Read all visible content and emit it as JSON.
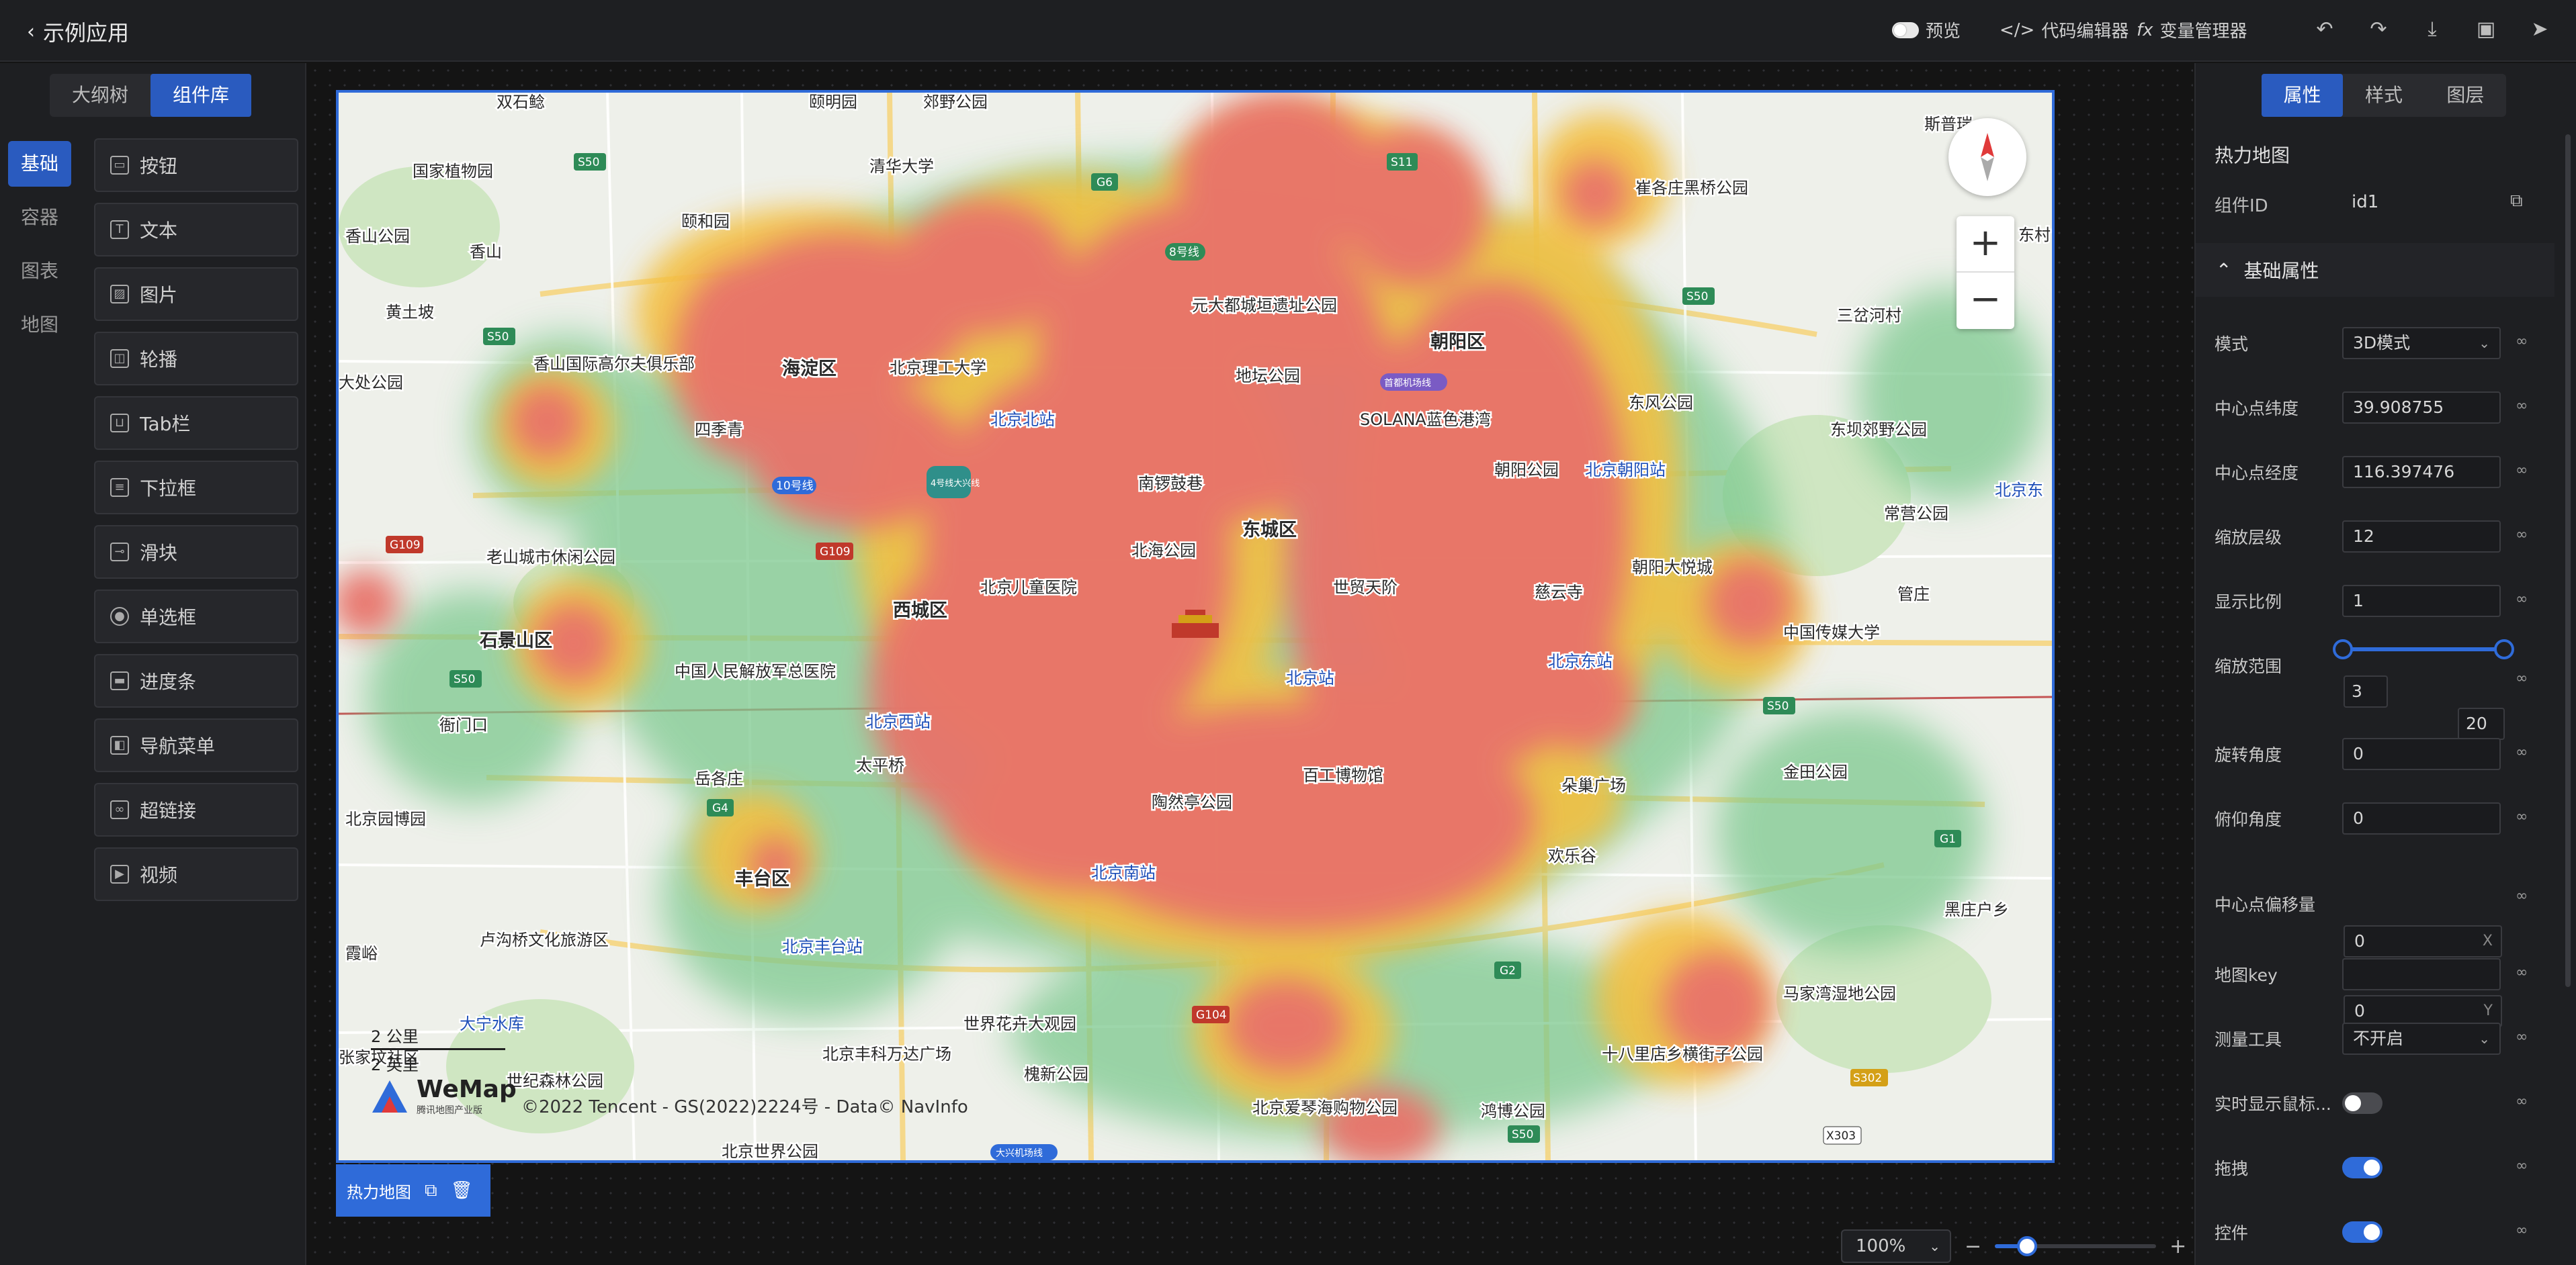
{
  "app": {
    "title": "示例应用"
  },
  "toolbar": {
    "preview_label": "预览",
    "code_editor_label": "代码编辑器",
    "variable_manager_label": "变量管理器"
  },
  "left_panel": {
    "tabs": [
      {
        "label": "大纲树",
        "active": false
      },
      {
        "label": "组件库",
        "active": true
      }
    ],
    "categories": [
      {
        "label": "基础",
        "active": true
      },
      {
        "label": "容器",
        "active": false
      },
      {
        "label": "图表",
        "active": false
      },
      {
        "label": "地图",
        "active": false
      }
    ],
    "components": [
      {
        "label": "按钮",
        "icon": "button-icon"
      },
      {
        "label": "文本",
        "icon": "text-icon"
      },
      {
        "label": "图片",
        "icon": "image-icon"
      },
      {
        "label": "轮播",
        "icon": "carousel-icon"
      },
      {
        "label": "Tab栏",
        "icon": "tabbar-icon"
      },
      {
        "label": "下拉框",
        "icon": "dropdown-icon"
      },
      {
        "label": "滑块",
        "icon": "slider-icon"
      },
      {
        "label": "单选框",
        "icon": "radio-icon"
      },
      {
        "label": "进度条",
        "icon": "progress-icon"
      },
      {
        "label": "导航菜单",
        "icon": "nav-menu-icon"
      },
      {
        "label": "超链接",
        "icon": "link-icon"
      },
      {
        "label": "视频",
        "icon": "video-icon"
      }
    ]
  },
  "map": {
    "labels": [
      {
        "text": "双石鲶"
      },
      {
        "text": "颐明园"
      },
      {
        "text": "郊野公园"
      },
      {
        "text": "清华大学"
      },
      {
        "text": "国家植物园"
      },
      {
        "text": "香山公园"
      },
      {
        "text": "颐和园"
      },
      {
        "text": "香山"
      },
      {
        "text": "黄土坡"
      },
      {
        "text": "香山国际高尔夫俱乐部"
      },
      {
        "text": "大处公园"
      },
      {
        "text": "海淀区"
      },
      {
        "text": "北京理工大学"
      },
      {
        "text": "四季青"
      },
      {
        "text": "元大都城垣遗址公园"
      },
      {
        "text": "地坛公园"
      },
      {
        "text": "朝阳区"
      },
      {
        "text": "北京北站"
      },
      {
        "text": "SOLANA蓝色港湾"
      },
      {
        "text": "朝阳公园"
      },
      {
        "text": "北京朝阳站"
      },
      {
        "text": "东风公园"
      },
      {
        "text": "东坝郊野公园"
      },
      {
        "text": "常营公园"
      },
      {
        "text": "崔各庄黑桥公园"
      },
      {
        "text": "三岔河村"
      },
      {
        "text": "斯普瑞"
      },
      {
        "text": "东村"
      },
      {
        "text": "老山城市休闲公园"
      },
      {
        "text": "南锣鼓巷"
      },
      {
        "text": "北海公园"
      },
      {
        "text": "东城区"
      },
      {
        "text": "北京儿童医院"
      },
      {
        "text": "西城区"
      },
      {
        "text": "世贸天阶"
      },
      {
        "text": "慈云寺"
      },
      {
        "text": "朝阳大悦城"
      },
      {
        "text": "管庄"
      },
      {
        "text": "中国传媒大学"
      },
      {
        "text": "石景山区"
      },
      {
        "text": "中国人民解放军总医院"
      },
      {
        "text": "北京站"
      },
      {
        "text": "北京东站"
      },
      {
        "text": "衙门口"
      },
      {
        "text": "北京西站"
      },
      {
        "text": "岳各庄"
      },
      {
        "text": "太平桥"
      },
      {
        "text": "百工博物馆"
      },
      {
        "text": "陶然亭公园"
      },
      {
        "text": "欢乐谷"
      },
      {
        "text": "朵巢广场"
      },
      {
        "text": "金田公园"
      },
      {
        "text": "北京园博园"
      },
      {
        "text": "丰台区"
      },
      {
        "text": "北京南站"
      },
      {
        "text": "黑庄户乡"
      },
      {
        "text": "卢沟桥文化旅游区"
      },
      {
        "text": "北京丰台站"
      },
      {
        "text": "霞峪"
      },
      {
        "text": "大宁水库"
      },
      {
        "text": "世界花卉大观园"
      },
      {
        "text": "马家湾湿地公园"
      },
      {
        "text": "张家坟社区"
      },
      {
        "text": "北京丰科万达广场"
      },
      {
        "text": "槐新公园"
      },
      {
        "text": "十八里店乡横街子公园"
      },
      {
        "text": "世纪森林公园"
      },
      {
        "text": "北京爱琴海购物公园"
      },
      {
        "text": "鸿博公园"
      },
      {
        "text": "北京世界公园"
      },
      {
        "text": "北京东"
      }
    ],
    "road_badges": [
      "S50",
      "G6",
      "S11",
      "S50",
      "S50",
      "G109",
      "G109",
      "S50",
      "G4",
      "G104",
      "G2",
      "S50",
      "G1",
      "S302",
      "X303",
      "S50",
      "10号线",
      "4号线大兴线",
      "8号线",
      "首都机场线",
      "大兴机场线"
    ],
    "scale_km": "2 公里",
    "scale_mi": "2 英里",
    "brand": "WeMap",
    "brand_sub": "腾讯地图产业版",
    "copyright": "©2022 Tencent - GS(2022)2224号 - Data© NavInfo",
    "heat_color_hot": "#e8736a",
    "heat_color_warm": "#f3c043",
    "heat_color_cool": "#7dc98f"
  },
  "selection_bar": {
    "label": "热力地图"
  },
  "bottom_bar": {
    "zoom_level": "100%",
    "zoom_value": 0.2
  },
  "right_panel": {
    "tabs": [
      {
        "label": "属性",
        "active": true
      },
      {
        "label": "样式",
        "active": false
      },
      {
        "label": "图层",
        "active": false
      }
    ],
    "component_title": "热力地图",
    "id_label": "组件ID",
    "id_value": "id1",
    "section_title": "基础属性",
    "props": {
      "mode": {
        "label": "模式",
        "value": "3D模式"
      },
      "center_lat": {
        "label": "中心点纬度",
        "value": "39.908755"
      },
      "center_lng": {
        "label": "中心点经度",
        "value": "116.397476"
      },
      "zoom": {
        "label": "缩放层级",
        "value": "12"
      },
      "scale": {
        "label": "显示比例",
        "value": "1"
      },
      "zoom_range": {
        "label": "缩放范围",
        "min": "3",
        "max": "20"
      },
      "rotation": {
        "label": "旋转角度",
        "value": "0"
      },
      "pitch": {
        "label": "俯仰角度",
        "value": "0"
      },
      "offset": {
        "label": "中心点偏移量",
        "x": "0",
        "y": "0",
        "x_suffix": "X",
        "y_suffix": "Y"
      },
      "map_key": {
        "label": "地图key",
        "value": ""
      },
      "measure": {
        "label": "测量工具",
        "value": "不开启"
      },
      "realtime": {
        "label": "实时显示鼠标...",
        "on": false
      },
      "drag": {
        "label": "拖拽",
        "on": true
      },
      "controls": {
        "label": "控件",
        "on": true
      }
    }
  },
  "colors": {
    "accent": "#2f6bd9",
    "panel": "#1e1f22",
    "canvas": "#141414"
  }
}
